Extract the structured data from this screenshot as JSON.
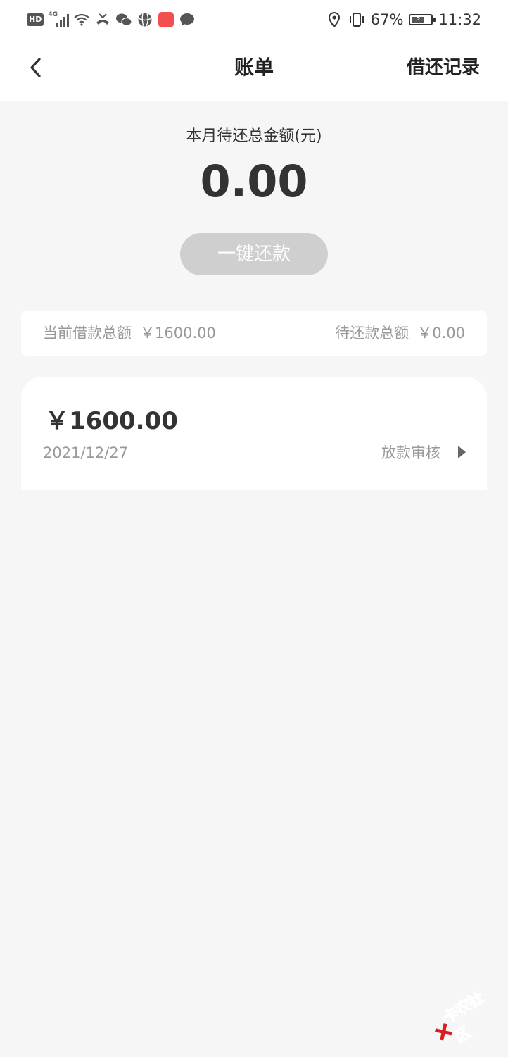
{
  "status_bar": {
    "network_badge": "HD",
    "network_type": "4G",
    "battery_percent": "67%",
    "time": "11:32",
    "battery_level": 0.67
  },
  "nav": {
    "title": "账单",
    "right_action": "借还记录"
  },
  "summary": {
    "label": "本月待还总金额(元)",
    "amount": "0.00",
    "repay_button": "一键还款"
  },
  "totals": {
    "borrowed_label": "当前借款总额",
    "borrowed_value": "￥1600.00",
    "due_label": "待还款总额",
    "due_value": "￥0.00"
  },
  "bills": [
    {
      "amount": "￥1600.00",
      "date": "2021/12/27",
      "status": "放款审核"
    }
  ],
  "watermark": {
    "text": "卡农社区"
  },
  "colors": {
    "page_bg": "#f6f6f6",
    "card_bg": "#ffffff",
    "button_disabled": "#cfcfcf",
    "watermark_red": "#d81e1e"
  }
}
